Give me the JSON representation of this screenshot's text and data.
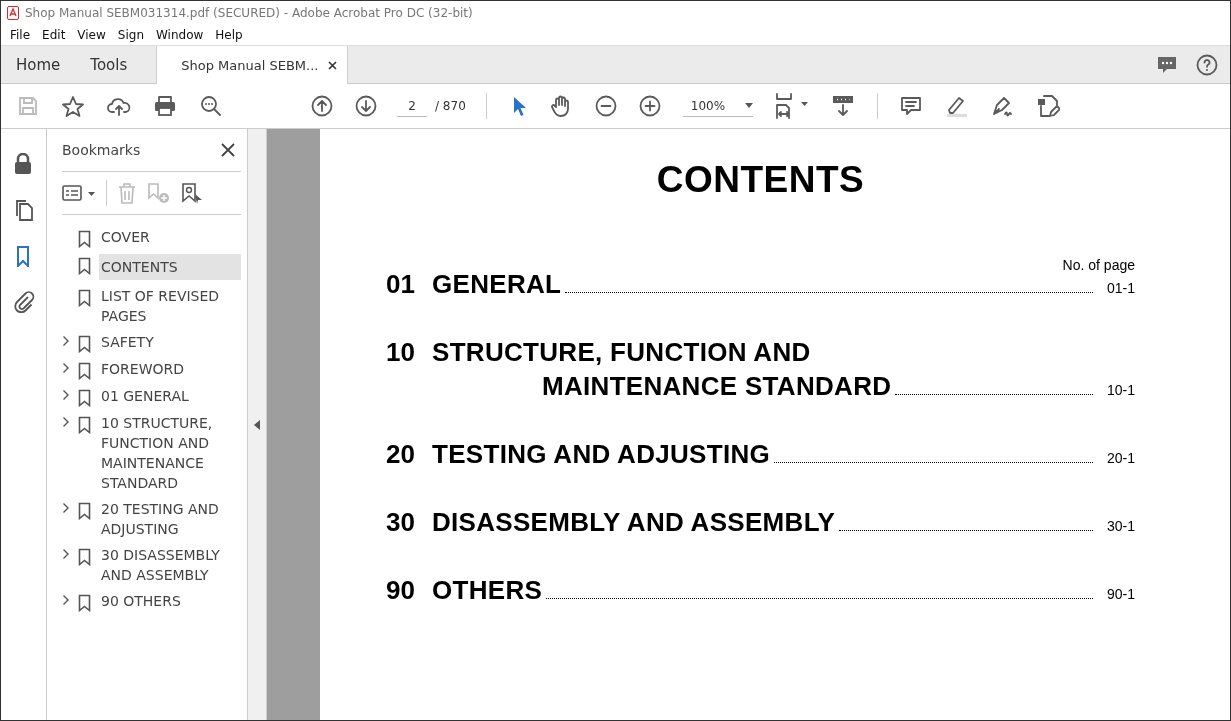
{
  "window": {
    "title": "Shop Manual SEBM031314.pdf (SECURED) - Adobe Acrobat Pro DC (32-bit)"
  },
  "menu": [
    "File",
    "Edit",
    "View",
    "Sign",
    "Window",
    "Help"
  ],
  "tabs": [
    {
      "label": "Home",
      "selected": false
    },
    {
      "label": "Tools",
      "selected": false
    },
    {
      "label": "Shop Manual SEBM...",
      "selected": true
    }
  ],
  "toolbar": {
    "page_value": "2",
    "page_total": "/ 870",
    "zoom": "100%"
  },
  "side_rail": [
    {
      "selected": false
    },
    {
      "selected": false
    },
    {
      "selected": true
    },
    {
      "selected": false
    }
  ],
  "bookmarks": {
    "title": "Bookmarks",
    "items": [
      {
        "label": "COVER",
        "kind": "leaf",
        "selected": false
      },
      {
        "label": "CONTENTS",
        "kind": "leaf",
        "selected": true
      },
      {
        "label": "LIST OF REVISED PAGES",
        "kind": "leaf",
        "selected": false
      },
      {
        "label": "SAFETY",
        "kind": "branch",
        "selected": false
      },
      {
        "label": "FOREWORD",
        "kind": "branch",
        "selected": false
      },
      {
        "label": "01 GENERAL",
        "kind": "branch",
        "selected": false
      },
      {
        "label": "10 STRUCTURE, FUNCTION AND MAINTENANCE STANDARD",
        "kind": "branch",
        "selected": false
      },
      {
        "label": "20 TESTING AND ADJUSTING",
        "kind": "branch",
        "selected": false
      },
      {
        "label": "30 DISASSEMBLY AND ASSEMBLY",
        "kind": "branch",
        "selected": false
      },
      {
        "label": "90 OTHERS",
        "kind": "branch",
        "selected": false
      }
    ]
  },
  "document": {
    "heading": "CONTENTS",
    "page_column_label": "No. of page",
    "entries": [
      {
        "number": "01",
        "title_lines": [
          "GENERAL"
        ],
        "page": "01-1"
      },
      {
        "number": "10",
        "title_lines": [
          "STRUCTURE, FUNCTION AND",
          "MAINTENANCE STANDARD"
        ],
        "page": "10-1"
      },
      {
        "number": "20",
        "title_lines": [
          "TESTING AND ADJUSTING"
        ],
        "page": "20-1"
      },
      {
        "number": "30",
        "title_lines": [
          "DISASSEMBLY AND ASSEMBLY"
        ],
        "page": "30-1"
      },
      {
        "number": "90",
        "title_lines": [
          "OTHERS"
        ],
        "page": "90-1"
      }
    ]
  }
}
